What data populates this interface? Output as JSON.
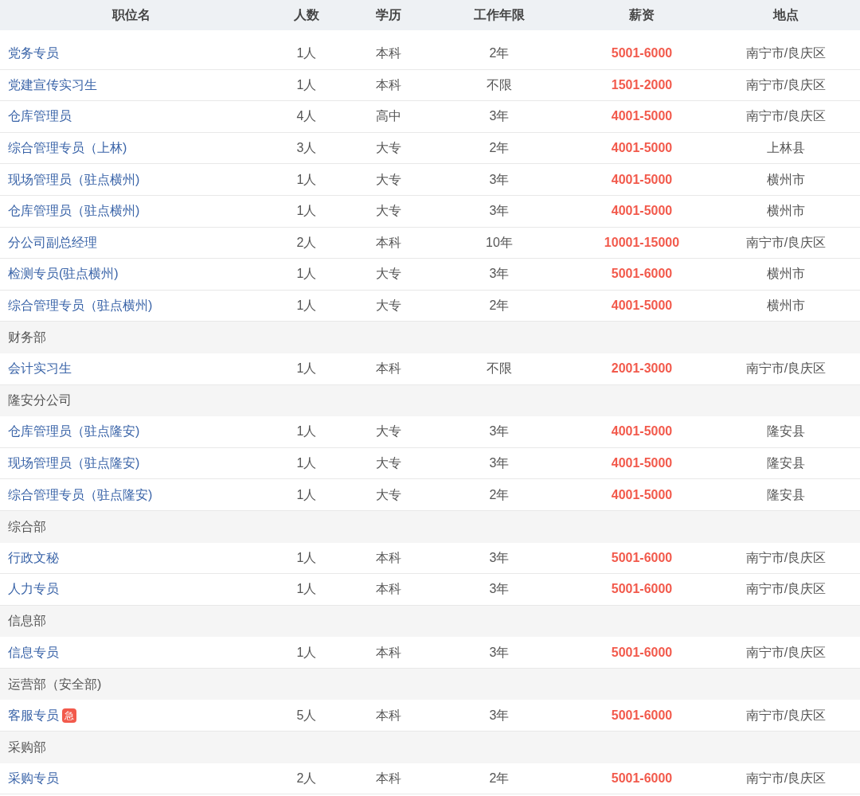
{
  "table": {
    "columns": [
      "职位名",
      "人数",
      "学历",
      "工作年限",
      "薪资",
      "地点"
    ],
    "rows": [
      {
        "kind": "job",
        "title": "党务专员",
        "count": "1人",
        "education": "本科",
        "experience": "2年",
        "salary": "5001-6000",
        "location": "南宁市/良庆区"
      },
      {
        "kind": "job",
        "title": "党建宣传实习生",
        "count": "1人",
        "education": "本科",
        "experience": "不限",
        "salary": "1501-2000",
        "location": "南宁市/良庆区"
      },
      {
        "kind": "job",
        "title": "仓库管理员",
        "count": "4人",
        "education": "高中",
        "experience": "3年",
        "salary": "4001-5000",
        "location": "南宁市/良庆区"
      },
      {
        "kind": "job",
        "title": "综合管理专员（上林)",
        "count": "3人",
        "education": "大专",
        "experience": "2年",
        "salary": "4001-5000",
        "location": "上林县"
      },
      {
        "kind": "job",
        "title": "现场管理员（驻点横州)",
        "count": "1人",
        "education": "大专",
        "experience": "3年",
        "salary": "4001-5000",
        "location": "横州市"
      },
      {
        "kind": "job",
        "title": "仓库管理员（驻点横州)",
        "count": "1人",
        "education": "大专",
        "experience": "3年",
        "salary": "4001-5000",
        "location": "横州市"
      },
      {
        "kind": "job",
        "title": "分公司副总经理",
        "count": "2人",
        "education": "本科",
        "experience": "10年",
        "salary": "10001-15000",
        "location": "南宁市/良庆区"
      },
      {
        "kind": "job",
        "title": "检测专员(驻点横州)",
        "count": "1人",
        "education": "大专",
        "experience": "3年",
        "salary": "5001-6000",
        "location": "横州市"
      },
      {
        "kind": "job",
        "title": "综合管理专员（驻点横州)",
        "count": "1人",
        "education": "大专",
        "experience": "2年",
        "salary": "4001-5000",
        "location": "横州市"
      },
      {
        "kind": "dept",
        "title": "财务部"
      },
      {
        "kind": "job",
        "title": "会计实习生",
        "count": "1人",
        "education": "本科",
        "experience": "不限",
        "salary": "2001-3000",
        "location": "南宁市/良庆区"
      },
      {
        "kind": "dept",
        "title": "隆安分公司"
      },
      {
        "kind": "job",
        "title": "仓库管理员（驻点隆安)",
        "count": "1人",
        "education": "大专",
        "experience": "3年",
        "salary": "4001-5000",
        "location": "隆安县"
      },
      {
        "kind": "job",
        "title": "现场管理员（驻点隆安)",
        "count": "1人",
        "education": "大专",
        "experience": "3年",
        "salary": "4001-5000",
        "location": "隆安县"
      },
      {
        "kind": "job",
        "title": "综合管理专员（驻点隆安)",
        "count": "1人",
        "education": "大专",
        "experience": "2年",
        "salary": "4001-5000",
        "location": "隆安县"
      },
      {
        "kind": "dept",
        "title": "综合部"
      },
      {
        "kind": "job",
        "title": "行政文秘",
        "count": "1人",
        "education": "本科",
        "experience": "3年",
        "salary": "5001-6000",
        "location": "南宁市/良庆区"
      },
      {
        "kind": "job",
        "title": "人力专员",
        "count": "1人",
        "education": "本科",
        "experience": "3年",
        "salary": "5001-6000",
        "location": "南宁市/良庆区"
      },
      {
        "kind": "dept",
        "title": "信息部"
      },
      {
        "kind": "job",
        "title": "信息专员",
        "count": "1人",
        "education": "本科",
        "experience": "3年",
        "salary": "5001-6000",
        "location": "南宁市/良庆区"
      },
      {
        "kind": "dept",
        "title": "运营部（安全部)"
      },
      {
        "kind": "job",
        "title": "客服专员",
        "badge": "急",
        "count": "5人",
        "education": "本科",
        "experience": "3年",
        "salary": "5001-6000",
        "location": "南宁市/良庆区"
      },
      {
        "kind": "dept",
        "title": "采购部"
      },
      {
        "kind": "job",
        "title": "采购专员",
        "count": "2人",
        "education": "本科",
        "experience": "2年",
        "salary": "5001-6000",
        "location": "南宁市/良庆区"
      }
    ]
  }
}
